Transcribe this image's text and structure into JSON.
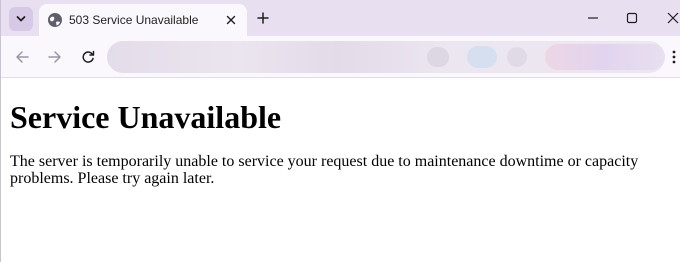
{
  "browser": {
    "tab": {
      "title": "503 Service Unavailable",
      "favicon": "globe-icon"
    },
    "icons": {
      "tab_search": "chevron-down-icon",
      "tab_close": "close-icon",
      "new_tab": "plus-icon",
      "minimize": "minimize-icon",
      "maximize": "maximize-icon",
      "close_window": "close-icon",
      "back": "arrow-left-icon",
      "forward": "arrow-right-icon",
      "reload": "reload-icon",
      "menu": "kebab-menu-icon"
    },
    "colors": {
      "tabstrip": "#e8dff0",
      "active_tab": "#fbf8fd",
      "omnibox": "#ece6f1"
    }
  },
  "page": {
    "heading": "Service Unavailable",
    "message": "The server is temporarily unable to service your request due to maintenance downtime or capacity problems. Please try again later."
  }
}
